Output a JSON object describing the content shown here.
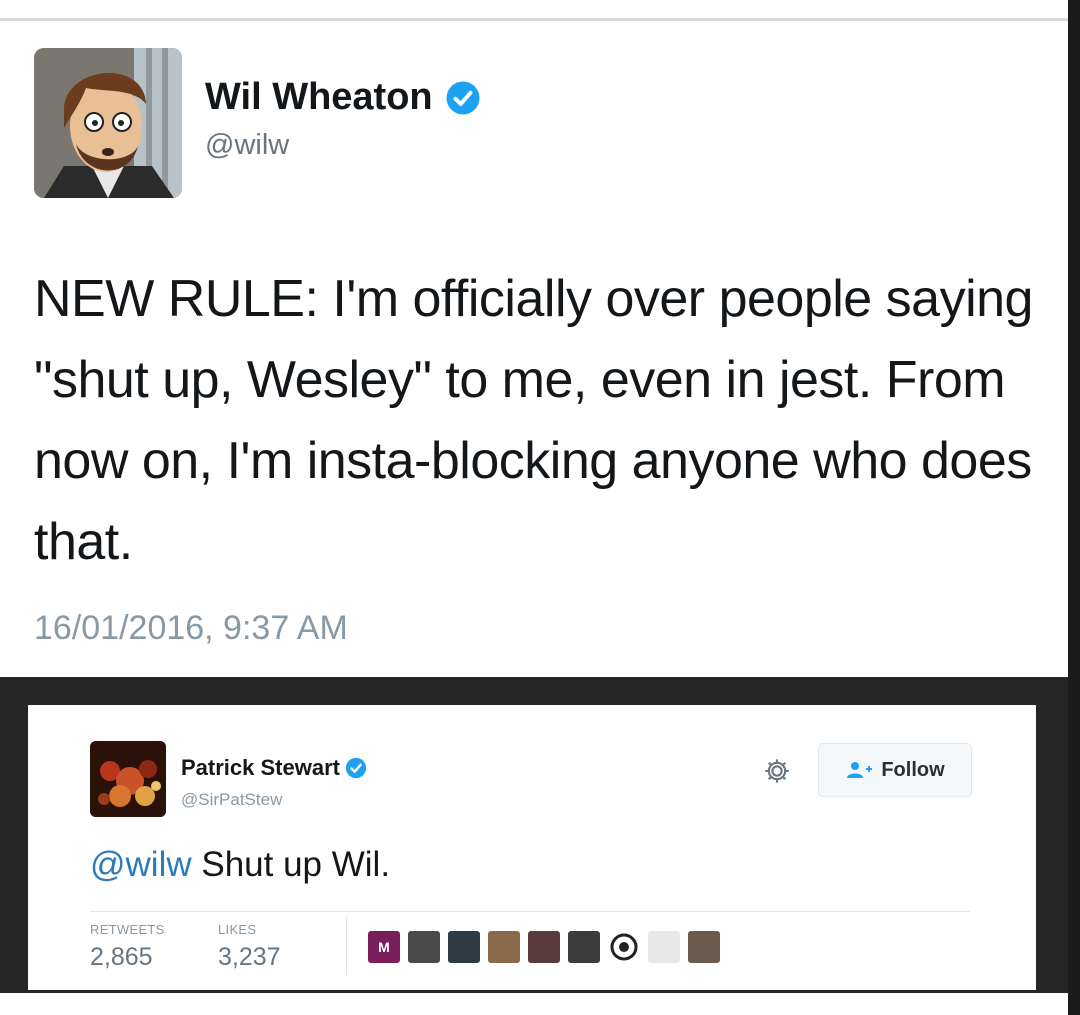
{
  "tweet1": {
    "author_name": "Wil Wheaton",
    "handle": "@wilw",
    "text": "NEW RULE: I'm officially over people saying \"shut up, Wesley\" to me, even in jest. From now on, I'm insta-blocking anyone who does that.",
    "timestamp": "16/01/2016, 9:37 AM",
    "icons": {
      "verified": "verified-badge-icon",
      "avatar": "cartoon-avatar"
    }
  },
  "tweet2": {
    "author_name": "Patrick Stewart",
    "handle": "@SirPatStew",
    "mention": "@wilw",
    "text": " Shut up Wil.",
    "follow_label": "Follow",
    "retweets_label": "RETWEETS",
    "retweets_count": "2,865",
    "likes_label": "LIKES",
    "likes_count": "3,237",
    "liker_badge_letter": "M",
    "icons": {
      "settings": "gear-icon",
      "follow": "add-user-icon",
      "verified": "verified-badge-icon"
    }
  },
  "colors": {
    "verified_blue": "#1da1f2",
    "mention_blue": "#2b7bb9",
    "secondary_text": "#66757f",
    "frame_dark": "#262626"
  }
}
